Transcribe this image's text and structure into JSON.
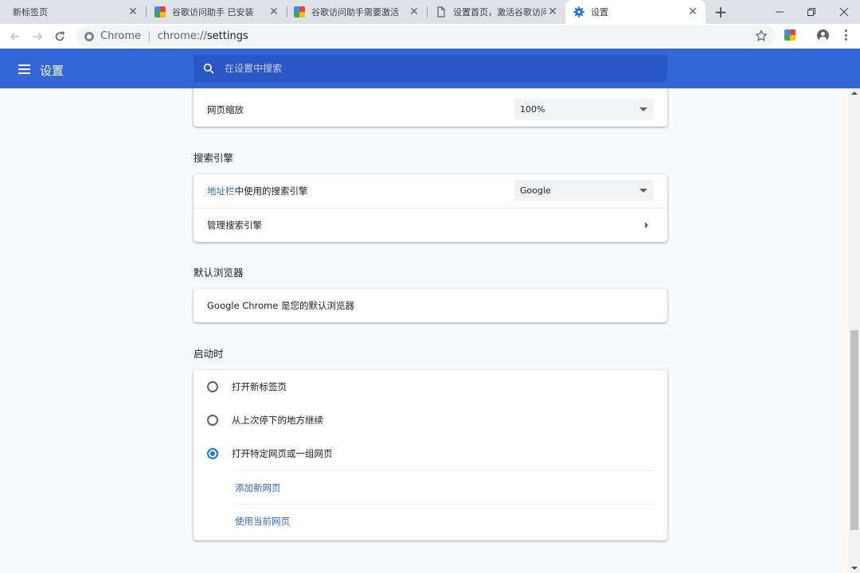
{
  "tabs": [
    {
      "title": "新标签页",
      "icon": "none"
    },
    {
      "title": "谷歌访问助手 已安装",
      "icon": "extension-multicolor-icon"
    },
    {
      "title": "谷歌访问助手需要激活",
      "icon": "extension-multicolor-icon"
    },
    {
      "title": "设置首页，激活谷歌访问",
      "icon": "document-icon"
    },
    {
      "title": "设置",
      "icon": "gear-icon",
      "active": true
    }
  ],
  "address_bar": {
    "label": "Chrome",
    "url_prefix": "chrome://",
    "url_path": "settings"
  },
  "header": {
    "title": "设置",
    "search_placeholder": "在设置中搜索"
  },
  "appearance": {
    "zoom_label": "网页缩放",
    "zoom_value": "100%"
  },
  "search_engine": {
    "title": "搜索引擎",
    "row1_link": "地址栏",
    "row1_text": "中使用的搜索引擎",
    "row1_value": "Google",
    "row2_text": "管理搜索引擎"
  },
  "default_browser": {
    "title": "默认浏览器",
    "text": "Google Chrome 是您的默认浏览器"
  },
  "startup": {
    "title": "启动时",
    "options": [
      {
        "label": "打开新标签页",
        "selected": false
      },
      {
        "label": "从上次停下的地方继续",
        "selected": false
      },
      {
        "label": "打开特定网页或一组网页",
        "selected": true
      }
    ],
    "add_page": "添加新网页",
    "use_current": "使用当前网页"
  },
  "colors": {
    "header_bg": "#3367d6",
    "search_bg": "#2a56c6",
    "link": "#3367d6",
    "radio_selected": "#1a73e8"
  }
}
